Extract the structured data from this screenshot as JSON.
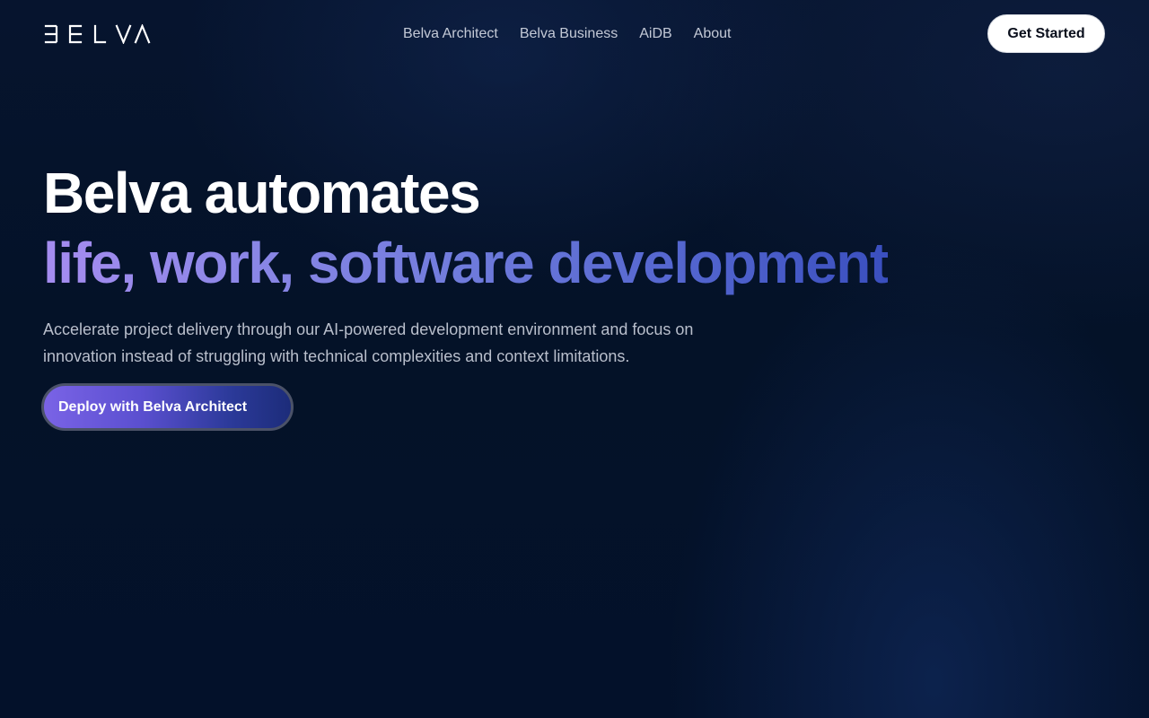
{
  "brand": {
    "logo_text": "BELVA"
  },
  "nav": {
    "links": [
      {
        "label": "Belva Architect"
      },
      {
        "label": "Belva Business"
      },
      {
        "label": "AiDB"
      },
      {
        "label": "About"
      }
    ],
    "cta_label": "Get Started"
  },
  "hero": {
    "headline_line1": "Belva automates",
    "headline_line2": "life, work, software development",
    "subtitle": "Accelerate project delivery through our AI-powered development environment and focus on innovation instead of struggling with technical complexities and context limitations.",
    "cta_label": "Deploy with Belva Architect"
  },
  "colors": {
    "background": "#03112a",
    "accent_gradient_start": "#a58cf0",
    "accent_gradient_end": "#3a4fbf",
    "primary_button": "#ffffff"
  }
}
